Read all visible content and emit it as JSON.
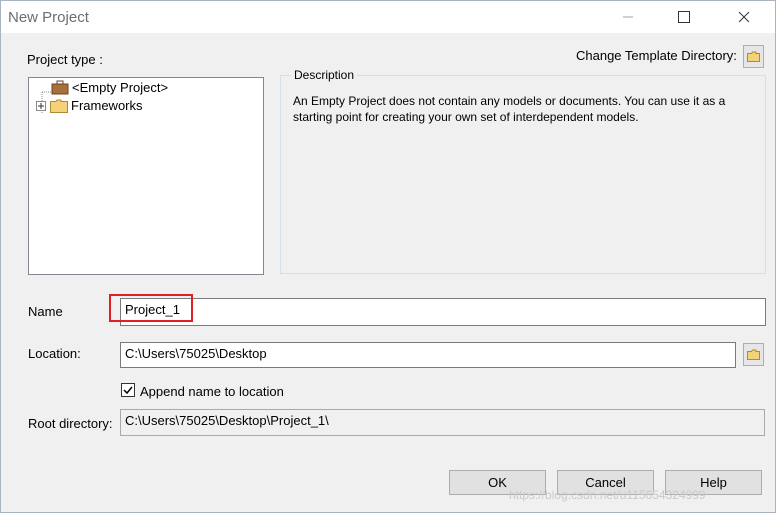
{
  "window": {
    "title": "New Project"
  },
  "labels": {
    "project_type": "Project type :",
    "change_template": "Change Template Directory:",
    "description_legend": "Description",
    "name": "Name",
    "location": "Location:",
    "append_name": "Append name to location",
    "root_directory": "Root directory:"
  },
  "tree": {
    "items": [
      {
        "label": "<Empty Project>",
        "icon": "briefcase-icon"
      },
      {
        "label": "Frameworks",
        "icon": "folder-icon",
        "expander": "plus"
      }
    ]
  },
  "description": "An Empty Project does not contain any models or documents. You can use it as a starting point for creating your own set of interdependent models.",
  "fields": {
    "name_value": "Project_1",
    "location_value": "C:\\Users\\75025\\Desktop",
    "root_value": "C:\\Users\\75025\\Desktop\\Project_1\\",
    "append_checked": true
  },
  "buttons": {
    "ok": "OK",
    "cancel": "Cancel",
    "help": "Help"
  },
  "watermark": "https://blog.csdn.net/u115654324999",
  "colors": {
    "highlight": "#e02020"
  }
}
